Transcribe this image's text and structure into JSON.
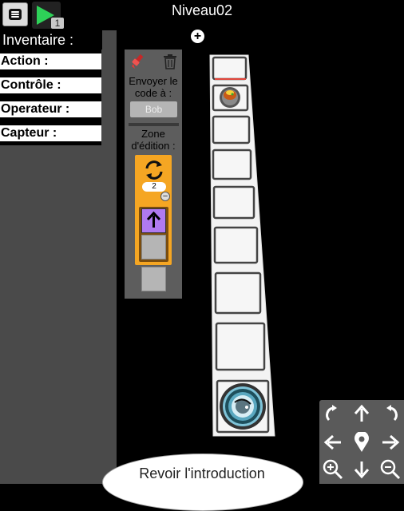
{
  "header": {
    "level_title": "Niveau02",
    "play_count": "1"
  },
  "inventory": {
    "title": "Inventaire :",
    "categories": [
      "Action :",
      "Contrôle :",
      "Operateur :",
      "Capteur :"
    ]
  },
  "editor": {
    "send_label_line1": "Envoyer le",
    "send_label_line2": "code à :",
    "agent_name": "Bob",
    "zone_label_line1": "Zone",
    "zone_label_line2": "d'édition :",
    "loop_count": "2",
    "inner_action_icon": "arrow-up-icon"
  },
  "board": {
    "tiles": 10,
    "start_tile": "player-robot",
    "goal_tile": "teleporter-exit"
  },
  "camera_controls": [
    "rotate-left-icon",
    "move-up-icon",
    "rotate-right-icon",
    "move-left-icon",
    "center-icon",
    "move-right-icon",
    "zoom-in-icon",
    "move-down-icon",
    "zoom-out-icon"
  ],
  "footer": {
    "intro_button": "Revoir l'introduction"
  },
  "colors": {
    "background": "#000000",
    "panel": "#4a4a4a",
    "editor_panel": "#5d5d5d",
    "loop_block": "#f5a623",
    "action_block": "#b07af0",
    "play": "#2ed158"
  }
}
